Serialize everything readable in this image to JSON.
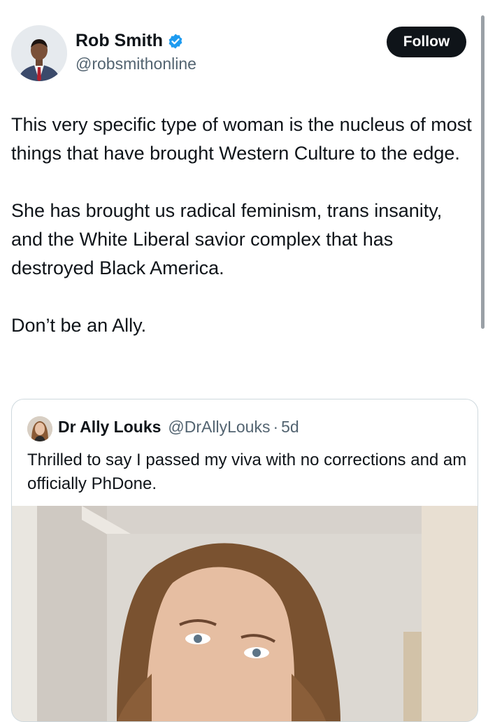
{
  "author": {
    "name": "Rob Smith",
    "handle": "@robsmithonline",
    "verified": true,
    "follow_label": "Follow"
  },
  "tweet": {
    "paragraphs": [
      "This very specific type of woman is the nucleus of most things that have brought Western Culture to the edge.",
      "She has brought us radical feminism, trans insanity, and the White Liberal savior complex that has destroyed Black America.",
      "Don’t be an Ally."
    ]
  },
  "quoted_tweet": {
    "name": "Dr Ally Louks",
    "handle": "@DrAllyLouks",
    "separator": "·",
    "time": "5d",
    "text": "Thrilled to say I passed my viva with no corrections and am officially PhDone."
  },
  "colors": {
    "text": "#0f1419",
    "secondary": "#536471",
    "verified": "#1d9bf0",
    "border": "#cfd9de",
    "follow_bg": "#0f1419"
  },
  "icons": {
    "verified": "verified-badge-icon"
  }
}
